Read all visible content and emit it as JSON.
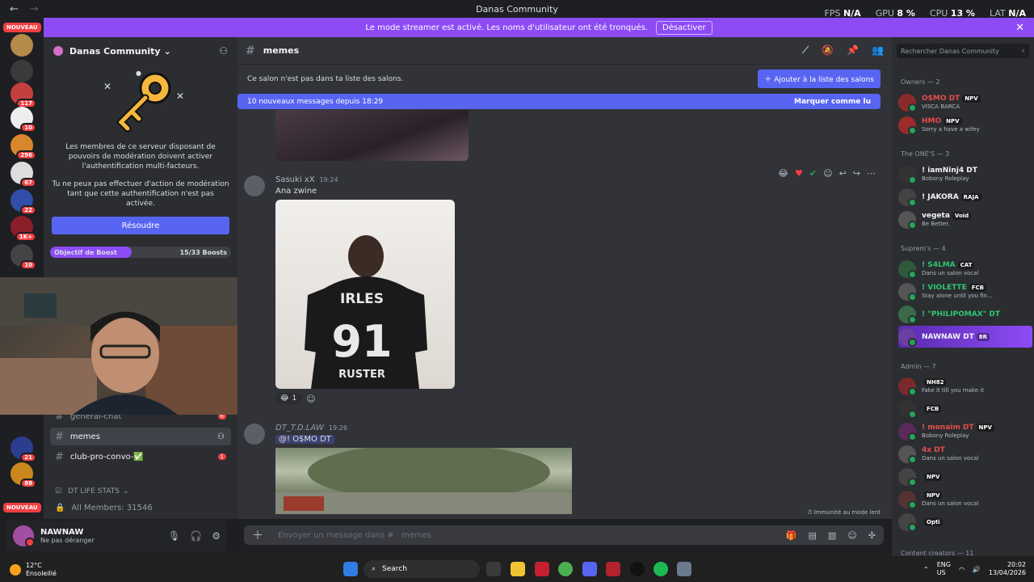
{
  "titlebar": {
    "title": "Danas Community",
    "back": "←",
    "forward": "→",
    "fps_label": "FPS",
    "fps_value": "N/A",
    "gpu_label": "GPU",
    "gpu_value": "8 %",
    "cpu_label": "CPU",
    "cpu_value": "13 %",
    "lat_label": "LAT",
    "lat_value": "N/A"
  },
  "banner": {
    "text": "Le mode streamer est activé. Les noms d'utilisateur ont été tronqués.",
    "button": "Désactiver",
    "close": "✕"
  },
  "servers": {
    "nouveau_top": "NOUVEAU",
    "nouveau_bottom": "NOUVEAU",
    "badges": [
      "117",
      "10",
      "296",
      "67",
      "22",
      "1K+",
      "10",
      "21",
      "88"
    ]
  },
  "guild": {
    "name": "Danas Community",
    "chevron": "⌄"
  },
  "mod_card": {
    "text1": "Les membres de ce serveur disposant de pouvoirs de modération doivent activer l'authentification multi-facteurs.",
    "text2": "Tu ne peux pas effectuer d'action de modération tant que cette authentification n'est pas activée.",
    "button": "Résoudre"
  },
  "boost": {
    "label": "Objectif de Boost",
    "count": "15/33 Boosts",
    "progress": 0.45
  },
  "channels": [
    {
      "name": "general-chat",
      "badge": "6"
    },
    {
      "name": "memes",
      "badge": ""
    },
    {
      "name": "club-pro-convo-✅",
      "badge": "1"
    }
  ],
  "category": {
    "name": "DT LIFE STATS"
  },
  "stats": {
    "members": "All Members: 31546"
  },
  "user": {
    "name": "NAWNAW",
    "status": "Ne pas déranger"
  },
  "chat": {
    "channel": "memes",
    "not_listed": "Ce salon n'est pas dans ta liste des salons.",
    "add_button": "Ajouter à la liste des salons",
    "new_messages": "10 nouveaux messages depuis 18:29",
    "mark_read": "Marquer comme lu",
    "messages": [
      {
        "user": "Sasuki xX",
        "time": "19:24",
        "text": "Ana zwine"
      },
      {
        "user": "DT_T.D.LAW",
        "time": "19:26",
        "text": "@!             O$MO DT"
      }
    ],
    "shirt_text_top": "IRLES",
    "shirt_number": "91",
    "shirt_text_bottom": "RUSTER",
    "reaction_count": "1",
    "slowmode": "Immunité au mode lent",
    "composer_placeholder": "Envoyer un message dans #  · memes"
  },
  "members": {
    "search_placeholder": "Rechercher Danas Community",
    "groups": [
      {
        "label": "Owners — 2"
      },
      {
        "label": "The ONE'S — 3"
      },
      {
        "label": "Suprem's — 4"
      },
      {
        "label": "Admin — 7"
      },
      {
        "label": "Content creators — 11"
      }
    ],
    "list": [
      {
        "name": "O$MO DT",
        "tag": "NPV",
        "status": "VISCA BARCA",
        "color": "#e54d4d"
      },
      {
        "name": "HMO",
        "tag": "NPV",
        "status": "Sorry a have a wifey",
        "color": "#e54d4d"
      },
      {
        "name": "! iamNinj4 DT",
        "tag": "",
        "status": "Bobony Roleplay",
        "color": "#f2f3f5"
      },
      {
        "name": "! JAKORA",
        "tag": "RAJA",
        "status": "",
        "color": "#f2f3f5"
      },
      {
        "name": "vegeta",
        "tag": "Void",
        "status": "Be Better.",
        "color": "#f2f3f5"
      },
      {
        "name": "! S4LMA",
        "tag": "CAT",
        "status": "Dans un salon vocal",
        "color": "#2dc770"
      },
      {
        "name": "! VIOLETTE",
        "tag": "FCB",
        "status": "Stay alone until you fin...",
        "color": "#2dc770"
      },
      {
        "name": "! \"PHILIPOMAX\" DT",
        "tag": "",
        "status": "",
        "color": "#2dc770"
      },
      {
        "name": "NAWNAW DT",
        "tag": "8R",
        "status": "",
        "color": "#f2f3f5"
      },
      {
        "name": "",
        "tag": "NH82",
        "status": "Fake it till you make it",
        "color": "#e54d4d"
      },
      {
        "name": "",
        "tag": "FCB",
        "status": "",
        "color": "#e54d4d"
      },
      {
        "name": "! monaim DT",
        "tag": "NPV",
        "status": "Bobony Roleplay",
        "color": "#e54d4d"
      },
      {
        "name": "4x DT",
        "tag": "",
        "status": "Dans un salon vocal",
        "color": "#e54d4d"
      },
      {
        "name": "",
        "tag": "NPV",
        "status": "",
        "color": "#e54d4d"
      },
      {
        "name": "",
        "tag": "NPV",
        "status": "Dans un salon vocal",
        "color": "#e54d4d"
      },
      {
        "name": "",
        "tag": "Opti",
        "status": "",
        "color": "#e54d4d"
      }
    ]
  },
  "taskbar": {
    "temp": "12°C",
    "weather": "Ensoleillé",
    "search": "Search",
    "lang1": "ENG",
    "lang2": "US",
    "time": "20:02",
    "date": "13/04/2026"
  }
}
